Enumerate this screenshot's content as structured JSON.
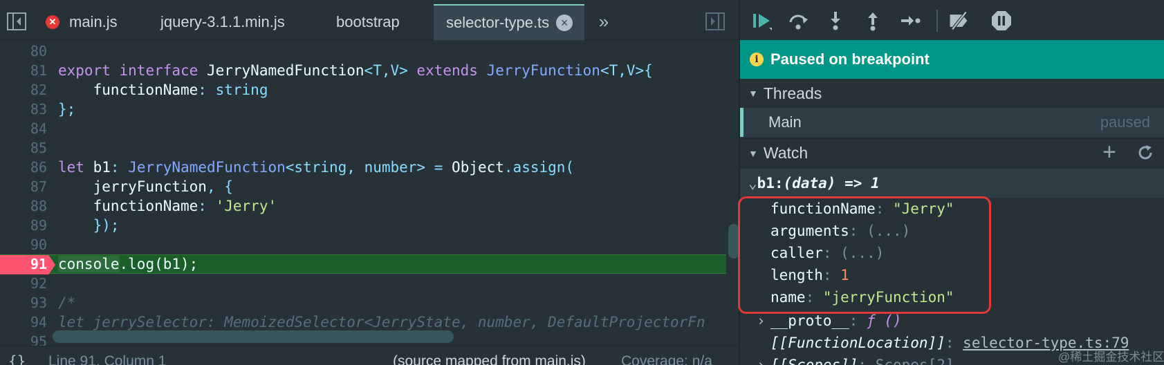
{
  "tabs": [
    {
      "label": "main.js",
      "has_error": true
    },
    {
      "label": "jquery-3.1.1.min.js"
    },
    {
      "label": "bootstrap"
    },
    {
      "label": "selector-type.ts",
      "active": true
    }
  ],
  "code_lines": [
    {
      "num": "80"
    },
    {
      "num": "81"
    },
    {
      "num": "82"
    },
    {
      "num": "83"
    },
    {
      "num": "84"
    },
    {
      "num": "85"
    },
    {
      "num": "86"
    },
    {
      "num": "87"
    },
    {
      "num": "88"
    },
    {
      "num": "89"
    },
    {
      "num": "90"
    },
    {
      "num": "91"
    },
    {
      "num": "92"
    },
    {
      "num": "93"
    },
    {
      "num": "94"
    },
    {
      "num": "95"
    }
  ],
  "code": {
    "l81": {
      "t1": "export",
      "t2": "interface",
      "t3": "JerryNamedFunction",
      "t4": "<T,V>",
      "t5": "extends",
      "t6": "JerryFunction",
      "t7": "<T,V>{"
    },
    "l82": {
      "t1": "functionName",
      "t2": ":",
      "t3": "string"
    },
    "l83": {
      "t1": "};"
    },
    "l86": {
      "t1": "let",
      "t2": "b1",
      "t3": ":",
      "t4": "JerryNamedFunction",
      "t5": "<string, number>",
      "t6": "=",
      "t7": "Object",
      "t8": ".assign("
    },
    "l87": {
      "t1": "jerryFunction",
      "t2": ", {"
    },
    "l88": {
      "t1": "functionName",
      "t2": ":",
      "t3": "'Jerry'"
    },
    "l89": {
      "t1": "});"
    },
    "l91": {
      "t1": "console",
      "t2": ".log(b1);"
    },
    "l93": {
      "t1": "/*"
    },
    "l94": {
      "t1": "let jerrySelector: MemoizedSelector<JerryState, number, DefaultProjectorFn"
    }
  },
  "status": {
    "position": "Line 91, Column 1",
    "source_map": "(source mapped from main.js)",
    "coverage": "Coverage: n/a"
  },
  "debugger": {
    "paused_message": "Paused on breakpoint",
    "threads_label": "Threads",
    "thread_name": "Main",
    "thread_state": "paused",
    "watch_label": "Watch",
    "watch_root": {
      "name": "b1",
      "sep": ":",
      "value": "(data) => 1"
    },
    "props": [
      {
        "key": "functionName",
        "value": "\"Jerry\""
      },
      {
        "key": "arguments",
        "value": "(...)"
      },
      {
        "key": "caller",
        "value": "(...)"
      },
      {
        "key": "length",
        "value": "1"
      },
      {
        "key": "name",
        "value": "\"jerryFunction\""
      }
    ],
    "proto": {
      "key": "__proto__",
      "value": "ƒ ()"
    },
    "fn_location": {
      "key": "[[FunctionLocation]]",
      "value": "selector-type.ts:79"
    },
    "scopes": {
      "key": "[[Scopes]]",
      "value": "Scopes[2]"
    }
  },
  "watermark": "@稀土掘金技术社区",
  "colors": {
    "accent": "#009688",
    "breakpoint": "#ff5370",
    "exec_line": "#1b5e2a"
  }
}
